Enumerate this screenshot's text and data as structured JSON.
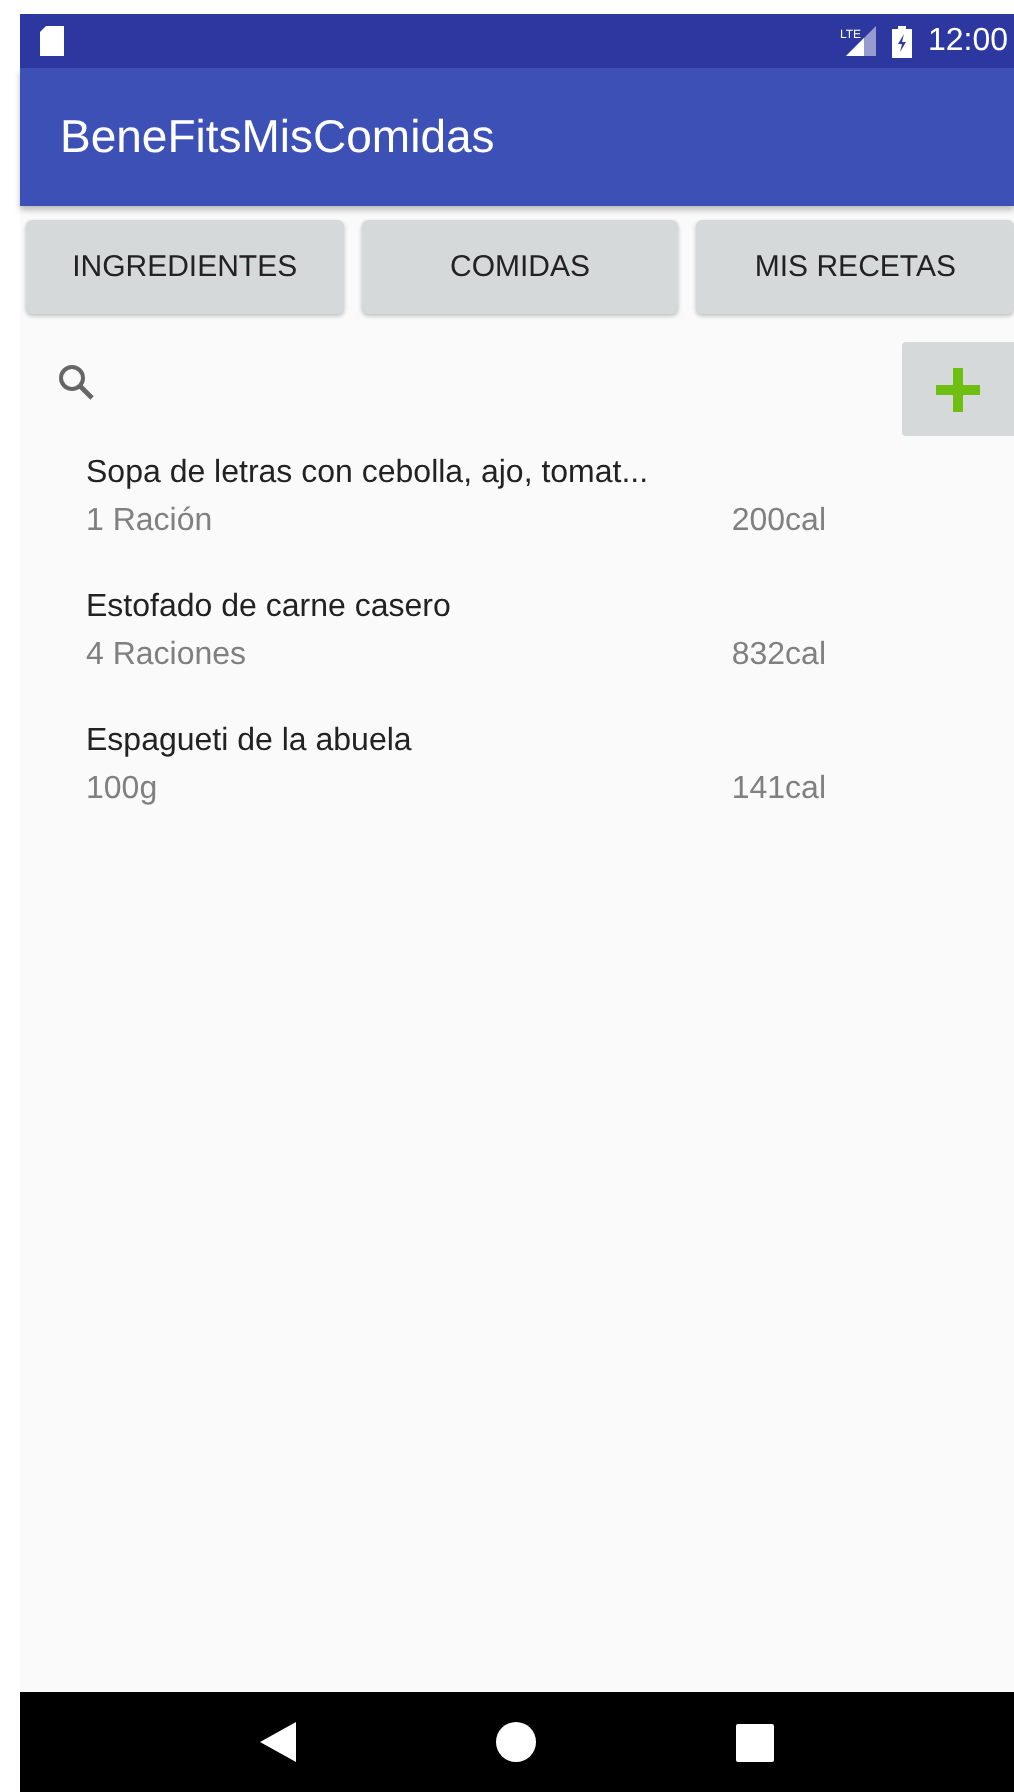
{
  "status_bar": {
    "time": "12:00",
    "network": "LTE"
  },
  "app_bar": {
    "title": "BeneFitsMisComidas"
  },
  "tabs": [
    {
      "label": "INGREDIENTES"
    },
    {
      "label": "COMIDAS"
    },
    {
      "label": "MIS RECETAS"
    }
  ],
  "meals": [
    {
      "name": "Sopa de letras con cebolla, ajo, tomat...",
      "portion": "1 Ración",
      "calories": "200cal"
    },
    {
      "name": "Estofado de carne casero",
      "portion": "4 Raciones",
      "calories": "832cal"
    },
    {
      "name": "Espagueti de la abuela",
      "portion": "100g",
      "calories": "141cal"
    }
  ]
}
